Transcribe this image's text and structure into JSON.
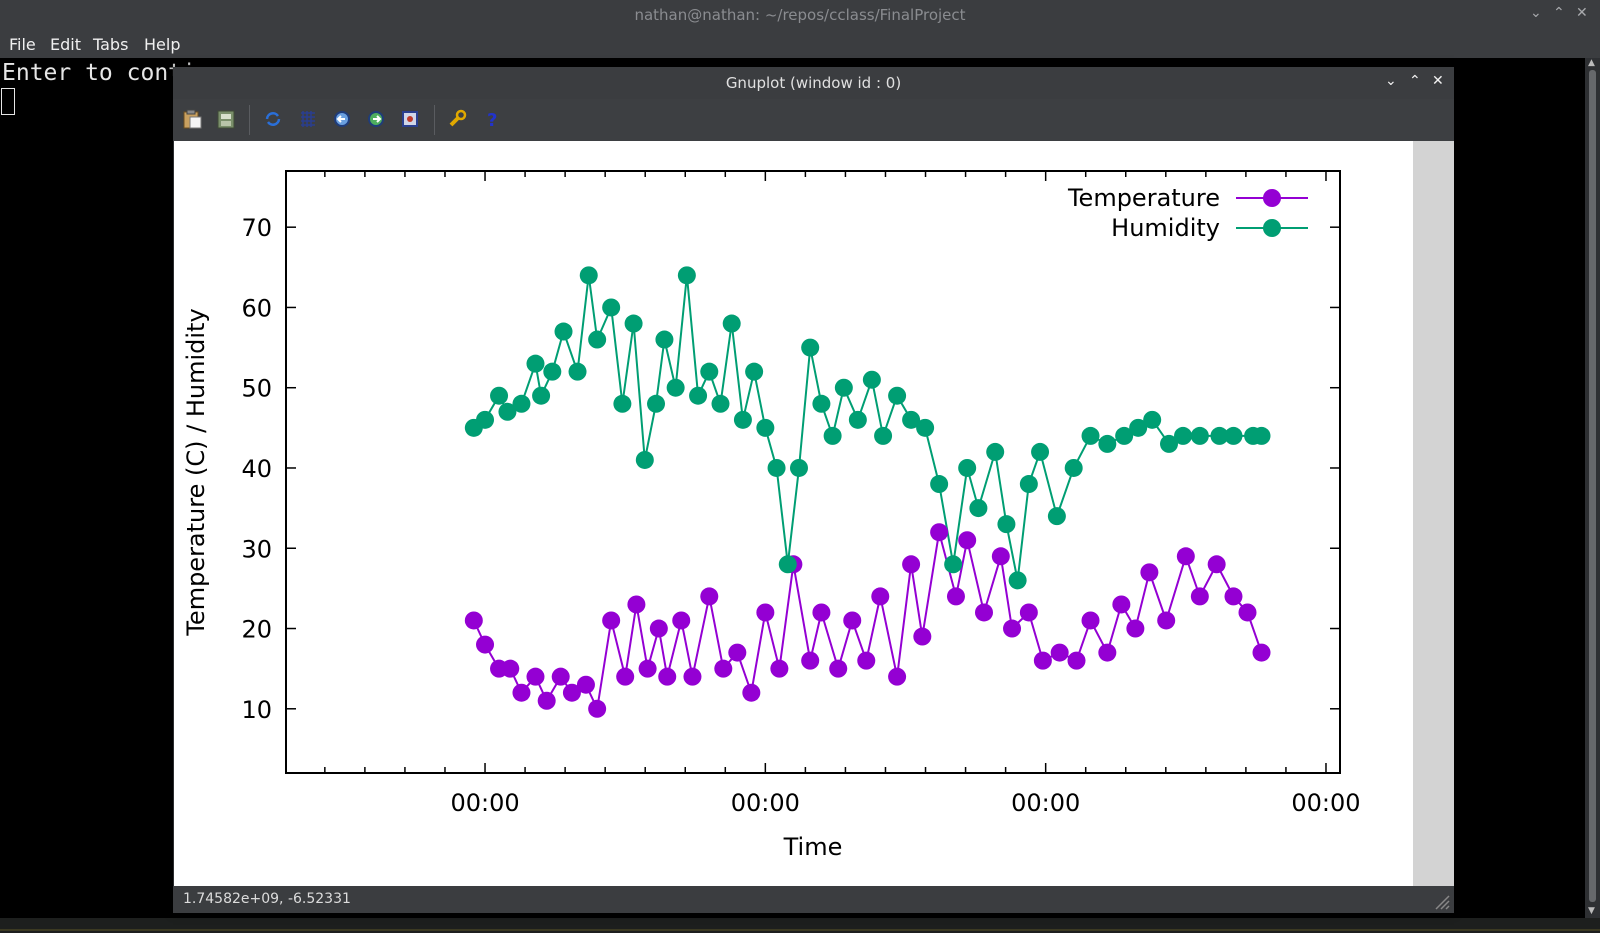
{
  "terminal": {
    "title": "nathan@nathan: ~/repos/cclass/FinalProject",
    "menu": [
      "File",
      "Edit",
      "Tabs",
      "Help"
    ],
    "line": "Enter to conti"
  },
  "gnuplot": {
    "title": "Gnuplot (window id : 0)",
    "status": "1.74582e+09, -6.52331",
    "toolbar": [
      "copy-to-clipboard",
      "print",
      "replot",
      "grid",
      "previous-zoom",
      "next-zoom",
      "autoscale",
      "options",
      "help"
    ]
  },
  "colors": {
    "temperature": "#9400d3",
    "humidity": "#009e73"
  },
  "chart_data": {
    "type": "line",
    "xlabel": "Time",
    "ylabel": "Temperature (C) / Humidity",
    "x_tick_labels": [
      "00:00",
      "00:00",
      "00:00",
      "00:00"
    ],
    "y_ticks": [
      10,
      20,
      30,
      40,
      50,
      60,
      70
    ],
    "ylim": [
      2,
      77
    ],
    "legend_position": "top-right",
    "grid": false,
    "x_unit": "days",
    "xlim": [
      -0.71,
      3.05
    ],
    "series": [
      {
        "name": "Temperature",
        "x": [
          -0.04,
          0.0,
          0.05,
          0.09,
          0.13,
          0.18,
          0.22,
          0.27,
          0.31,
          0.36,
          0.4,
          0.45,
          0.5,
          0.54,
          0.58,
          0.62,
          0.65,
          0.7,
          0.74,
          0.8,
          0.85,
          0.9,
          0.95,
          1.0,
          1.05,
          1.1,
          1.16,
          1.2,
          1.26,
          1.31,
          1.36,
          1.41,
          1.47,
          1.52,
          1.56,
          1.62,
          1.68,
          1.72,
          1.78,
          1.84,
          1.88,
          1.94,
          1.99,
          2.05,
          2.11,
          2.16,
          2.22,
          2.27,
          2.32,
          2.37,
          2.43,
          2.5,
          2.55,
          2.61,
          2.67,
          2.72,
          2.77
        ],
        "y": [
          21,
          18,
          15,
          15,
          12,
          14,
          11,
          14,
          12,
          13,
          10,
          21,
          14,
          23,
          15,
          20,
          14,
          21,
          14,
          24,
          15,
          17,
          12,
          22,
          15,
          28,
          16,
          22,
          15,
          21,
          16,
          24,
          14,
          28,
          19,
          32,
          24,
          31,
          22,
          29,
          20,
          22,
          16,
          17,
          16,
          21,
          17,
          23,
          20,
          27,
          21,
          29,
          24,
          28,
          24,
          22,
          17
        ]
      },
      {
        "name": "Humidity",
        "x": [
          -0.04,
          0.0,
          0.05,
          0.08,
          0.13,
          0.18,
          0.2,
          0.24,
          0.28,
          0.33,
          0.37,
          0.4,
          0.45,
          0.49,
          0.53,
          0.57,
          0.61,
          0.64,
          0.68,
          0.72,
          0.76,
          0.8,
          0.84,
          0.88,
          0.92,
          0.96,
          1.0,
          1.04,
          1.08,
          1.12,
          1.16,
          1.2,
          1.24,
          1.28,
          1.33,
          1.38,
          1.42,
          1.47,
          1.52,
          1.57,
          1.62,
          1.67,
          1.72,
          1.76,
          1.82,
          1.86,
          1.9,
          1.94,
          1.98,
          2.04,
          2.1,
          2.16,
          2.22,
          2.28,
          2.33,
          2.38,
          2.44,
          2.49,
          2.55,
          2.62,
          2.67,
          2.74,
          2.77
        ],
        "y": [
          45,
          46,
          49,
          47,
          48,
          53,
          49,
          52,
          57,
          52,
          64,
          56,
          60,
          48,
          58,
          41,
          48,
          56,
          50,
          64,
          49,
          52,
          48,
          58,
          46,
          52,
          45,
          40,
          28,
          40,
          55,
          48,
          44,
          50,
          46,
          51,
          44,
          49,
          46,
          45,
          38,
          28,
          40,
          35,
          42,
          33,
          26,
          38,
          42,
          34,
          40,
          44,
          43,
          44,
          45,
          46,
          43,
          44,
          44,
          44,
          44,
          44,
          44
        ]
      }
    ]
  }
}
